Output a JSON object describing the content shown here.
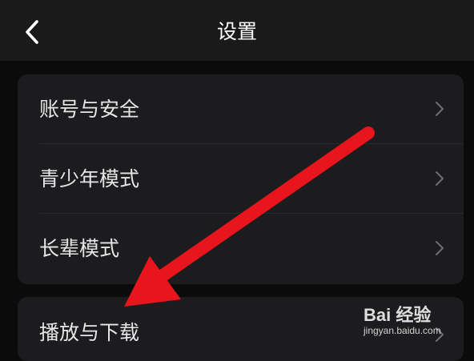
{
  "header": {
    "title": "设置",
    "back_icon": "chevron-left-icon"
  },
  "settings_group_1": {
    "items": [
      {
        "label": "账号与安全",
        "icon": "chevron-right-icon"
      },
      {
        "label": "青少年模式",
        "icon": "chevron-right-icon"
      },
      {
        "label": "长辈模式",
        "icon": "chevron-right-icon"
      }
    ]
  },
  "settings_group_2": {
    "items": [
      {
        "label": "播放与下载",
        "icon": "chevron-right-icon"
      }
    ]
  },
  "annotation": {
    "arrow_color": "#e8161c"
  },
  "watermark": {
    "brand": "Bai 经验",
    "url": "jingyan.baidu.com"
  },
  "colors": {
    "background": "#0b0b0c",
    "header": "#1a1a1b",
    "card": "#1c1c1e",
    "text": "#e6e6e6"
  }
}
